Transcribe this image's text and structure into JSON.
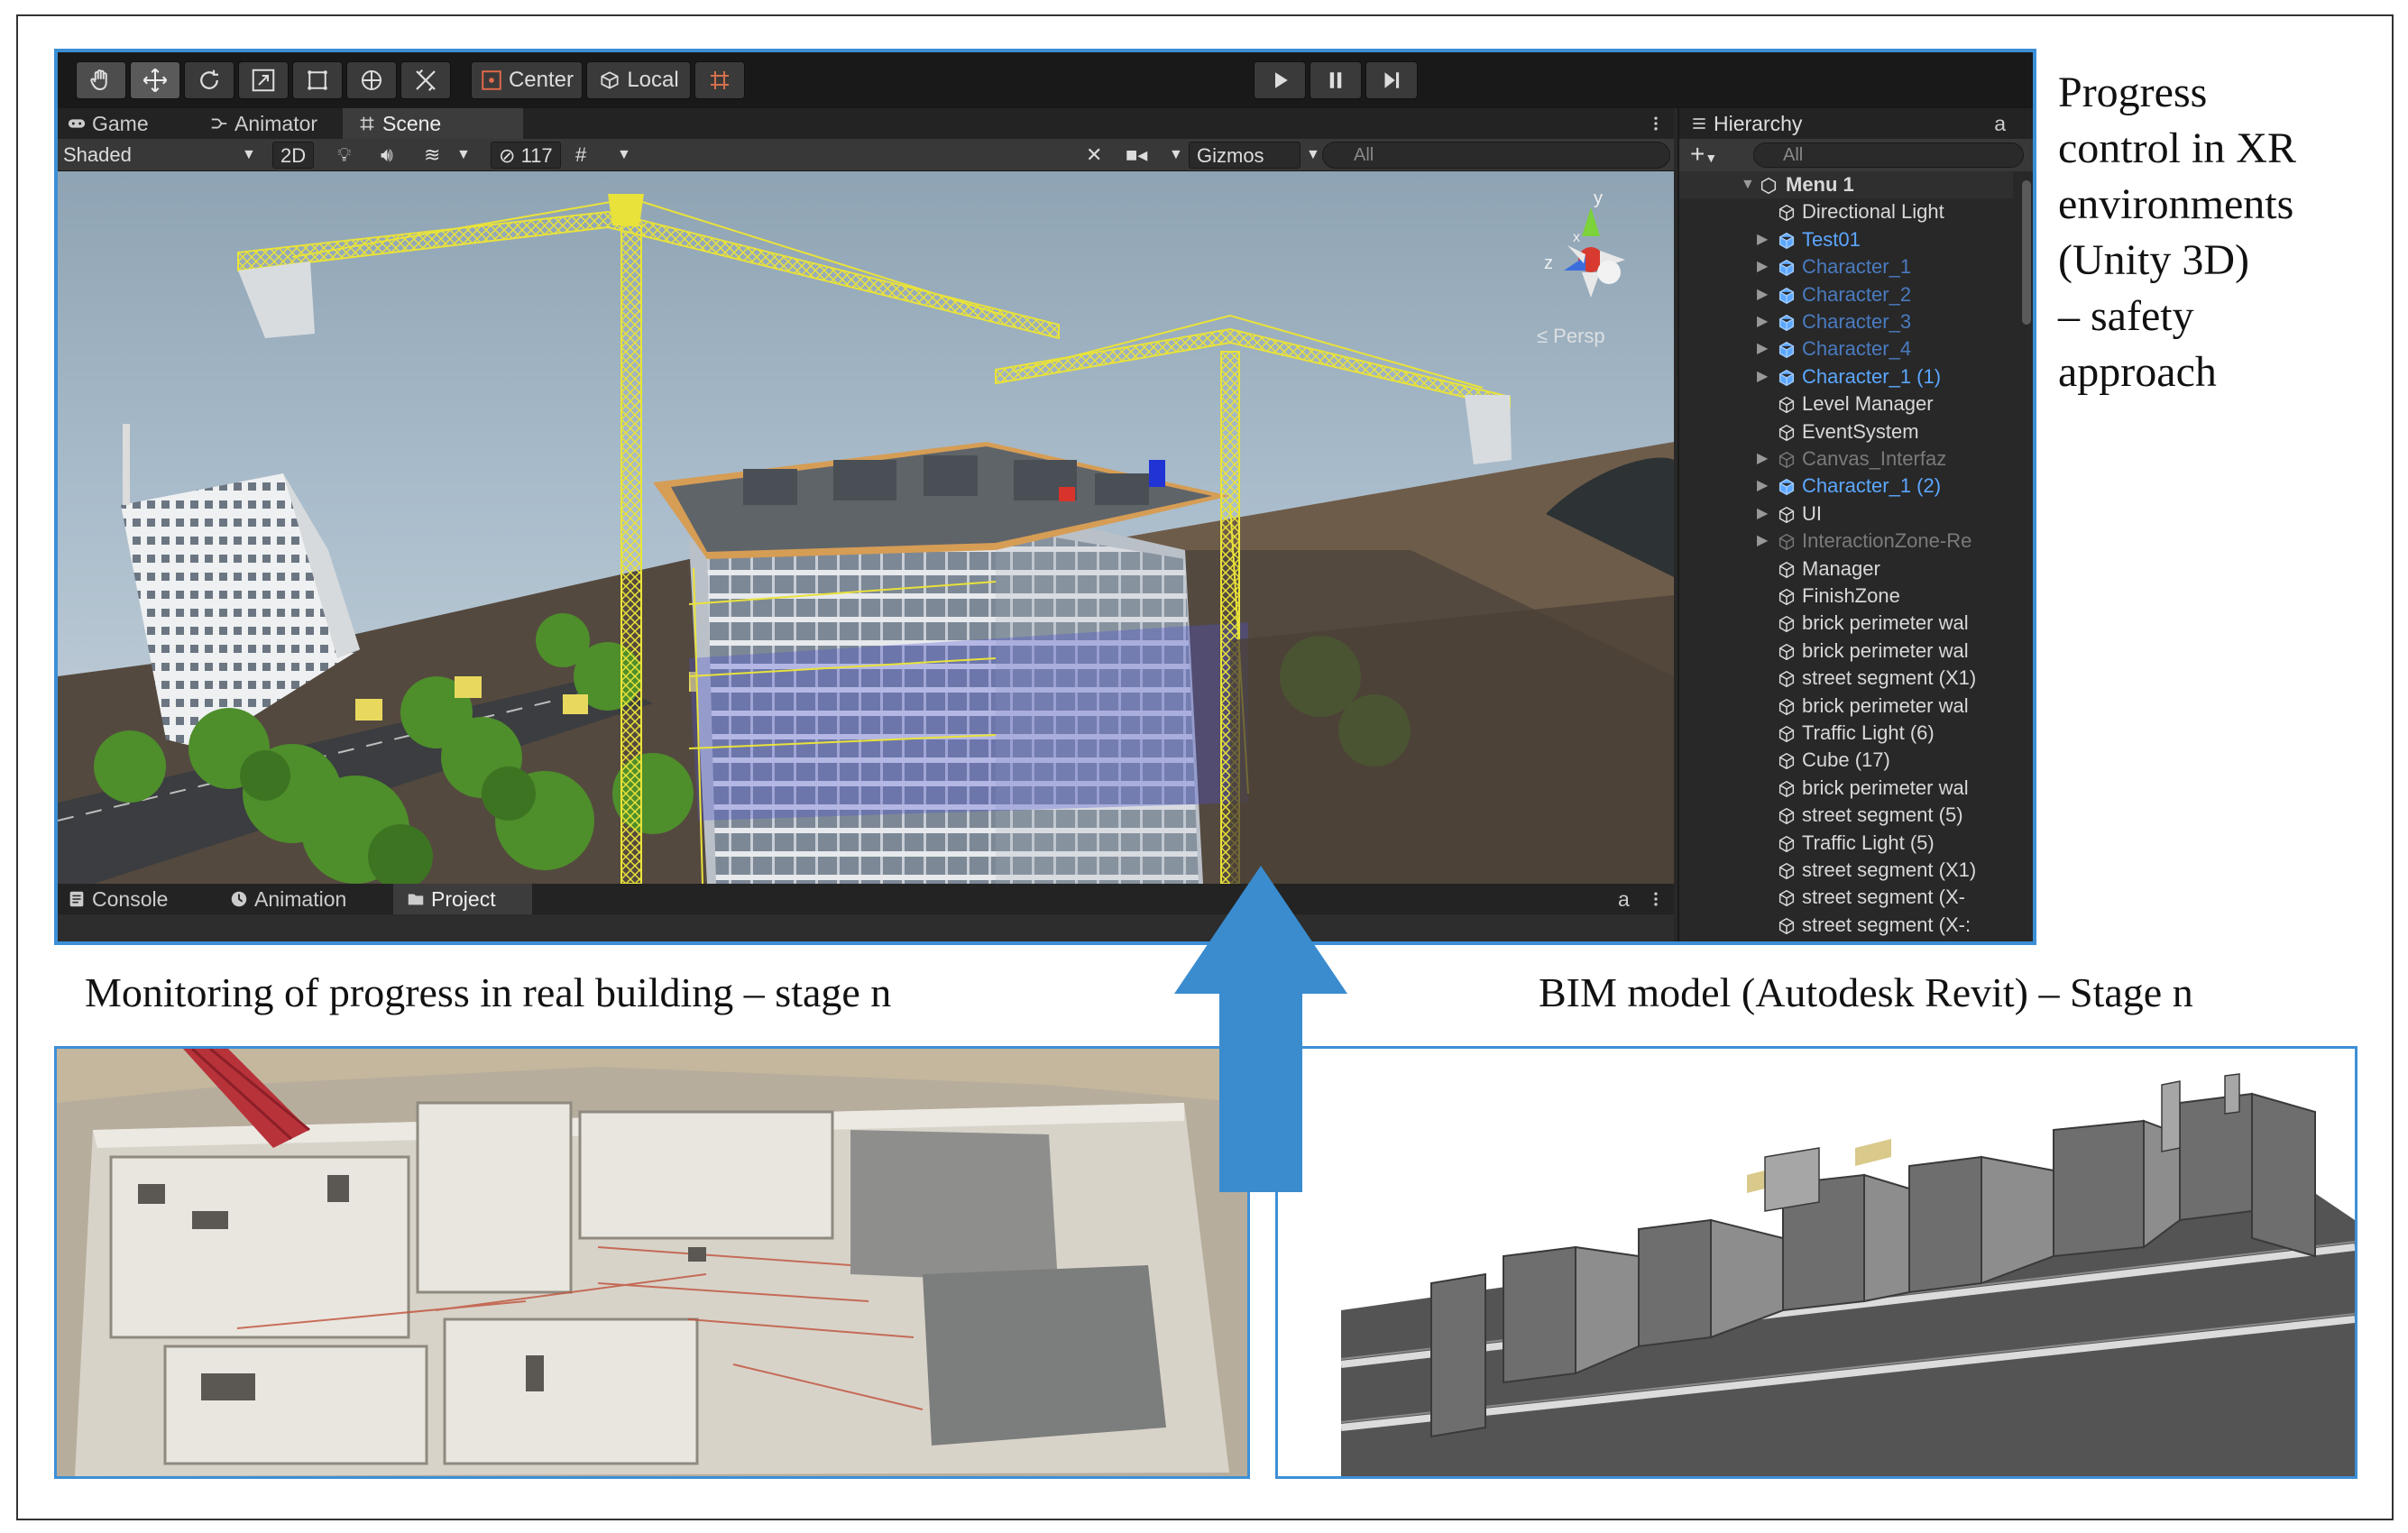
{
  "captions": {
    "unity_lines": [
      "Progress",
      "control in XR",
      "environments",
      "(Unity 3D)",
      "– safety",
      "approach"
    ],
    "real": "Monitoring of progress in real building – stage n",
    "bim": "BIM model (Autodesk  Revit) – Stage n"
  },
  "unity": {
    "toolbar": {
      "center_label": "Center",
      "local_label": "Local"
    },
    "tabs_top": [
      {
        "label": "Game",
        "icon": "gamepad-icon"
      },
      {
        "label": "Animator",
        "icon": "animator-icon"
      },
      {
        "label": "Scene",
        "icon": "grid-icon"
      }
    ],
    "scene_toolbar": {
      "shading": "Shaded",
      "mode_2d": "2D",
      "hidden_count": "117",
      "gizmos": "Gizmos",
      "search_placeholder": "All"
    },
    "viewport": {
      "persp_label": "≤ Persp",
      "gizmo_y": "y",
      "gizmo_z": "z",
      "gizmo_x": "x"
    },
    "tabs_bottom": [
      {
        "label": "Console",
        "icon": "console-icon"
      },
      {
        "label": "Animation",
        "icon": "animation-icon"
      },
      {
        "label": "Project",
        "icon": "folder-icon"
      }
    ],
    "hierarchy": {
      "title": "Hierarchy",
      "search_placeholder": "All",
      "scene_root": "Menu 1",
      "items": [
        {
          "label": "Directional Light",
          "kind": "object",
          "expandable": false
        },
        {
          "label": "Test01",
          "kind": "prefab",
          "expandable": true
        },
        {
          "label": "Character_1",
          "kind": "prefab-dim",
          "expandable": true
        },
        {
          "label": "Character_2",
          "kind": "prefab-dim",
          "expandable": true
        },
        {
          "label": "Character_3",
          "kind": "prefab-dim",
          "expandable": true
        },
        {
          "label": "Character_4",
          "kind": "prefab-dim",
          "expandable": true
        },
        {
          "label": "Character_1 (1)",
          "kind": "prefab",
          "expandable": true
        },
        {
          "label": "Level Manager",
          "kind": "object",
          "expandable": false
        },
        {
          "label": "EventSystem",
          "kind": "object",
          "expandable": false
        },
        {
          "label": "Canvas_Interfaz",
          "kind": "dim",
          "expandable": true
        },
        {
          "label": "Character_1 (2)",
          "kind": "prefab",
          "expandable": true
        },
        {
          "label": "UI",
          "kind": "object",
          "expandable": true
        },
        {
          "label": "InteractionZone-Re",
          "kind": "dim",
          "expandable": true
        },
        {
          "label": "Manager",
          "kind": "object",
          "expandable": false
        },
        {
          "label": "FinishZone",
          "kind": "object",
          "expandable": false
        },
        {
          "label": "brick perimeter wal",
          "kind": "object",
          "expandable": false
        },
        {
          "label": "brick perimeter wal",
          "kind": "object",
          "expandable": false
        },
        {
          "label": "street segment (X1)",
          "kind": "object",
          "expandable": false
        },
        {
          "label": "brick perimeter wal",
          "kind": "object",
          "expandable": false
        },
        {
          "label": "Traffic Light (6)",
          "kind": "object",
          "expandable": false
        },
        {
          "label": "Cube (17)",
          "kind": "object",
          "expandable": false
        },
        {
          "label": "brick perimeter wal",
          "kind": "object",
          "expandable": false
        },
        {
          "label": "street segment (5)",
          "kind": "object",
          "expandable": false
        },
        {
          "label": "Traffic Light (5)",
          "kind": "object",
          "expandable": false
        },
        {
          "label": "street segment (X1)",
          "kind": "object",
          "expandable": false
        },
        {
          "label": "street segment (X-",
          "kind": "object",
          "expandable": false
        },
        {
          "label": "street segment (X-:",
          "kind": "object",
          "expandable": false
        }
      ]
    }
  },
  "colors": {
    "accent_border": "#3c8fd6",
    "crane_yellow": "#e9e23a",
    "prefab_blue": "#5ca7ff",
    "editor_dark": "#282828"
  }
}
